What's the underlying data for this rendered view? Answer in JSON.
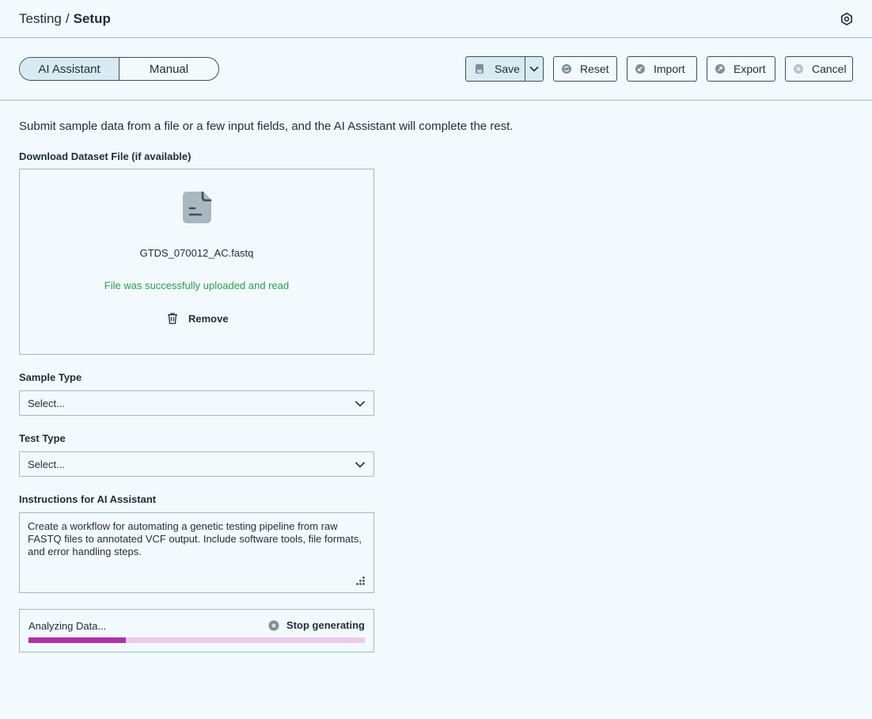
{
  "header": {
    "breadcrumb_parent": "Testing",
    "breadcrumb_sep": "/",
    "breadcrumb_current": "Setup",
    "settings_icon": "gear-icon"
  },
  "toolbar": {
    "mode_tabs": [
      {
        "label": "AI Assistant",
        "active": true
      },
      {
        "label": "Manual",
        "active": false
      }
    ],
    "save_label": "Save",
    "reset_label": "Reset",
    "import_label": "Import",
    "export_label": "Export",
    "cancel_label": "Cancel"
  },
  "main": {
    "intro": "Submit sample data from a file or a few input fields, and the AI Assistant will complete the rest.",
    "dataset": {
      "label": "Download Dataset File (if available)",
      "file_name": "GTDS_070012_AC.fastq",
      "status": "File was successfully uploaded and read",
      "remove_label": "Remove"
    },
    "sample_type": {
      "label": "Sample Type",
      "value": "Select..."
    },
    "test_type": {
      "label": "Test Type",
      "value": "Select..."
    },
    "instructions": {
      "label": "Instructions for AI Assistant",
      "value": "Create a workflow for automating a genetic testing pipeline from raw FASTQ files to annotated VCF output. Include software tools, file formats, and error handling steps."
    },
    "progress": {
      "text": "Analyzing Data...",
      "stop_label": "Stop generating",
      "fraction": 0.29
    }
  },
  "colors": {
    "background": "#f3fafd",
    "accent_active": "#d8ebf2",
    "success": "#2e9a52",
    "progress_fill": "#b030a8",
    "progress_track": "#ecc9ea"
  }
}
